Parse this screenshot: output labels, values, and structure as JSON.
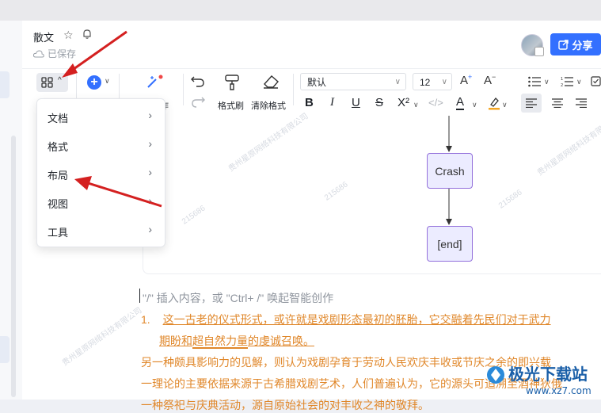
{
  "header": {
    "doc_title": "散文",
    "saved_status": "已保存",
    "share_label": "分享"
  },
  "toolbar": {
    "insert_suffix": "作",
    "format_painter": "格式刷",
    "clear_format": "清除格式",
    "font_family": "默认",
    "font_size": "12",
    "bold": "B",
    "italic": "I",
    "underline": "U",
    "strike": "S",
    "superscript": "X²",
    "text_color": "A"
  },
  "menu": {
    "items": [
      {
        "label": "文档"
      },
      {
        "label": "格式"
      },
      {
        "label": "布局"
      },
      {
        "label": "视图"
      },
      {
        "label": "工具"
      }
    ]
  },
  "diagram": {
    "nodes": [
      {
        "label": "Crash"
      },
      {
        "label": "[end]"
      }
    ]
  },
  "editor": {
    "placeholder": "\"/\" 插入内容，或 \"Ctrl+ /\" 唤起智能创作",
    "list_number": "1.",
    "line1": "这一古老的仪式形式，或许就是戏剧形态最初的胚胎，它交融着先民们对于武力",
    "line2_a": "期盼和",
    "line2_b": "超自然力量",
    "line2_c": "的虔诚召唤。",
    "line3": "另一种颇具影响力的见解，则认为戏剧孕育于劳动人民欢庆丰收或节庆之余的即兴载",
    "line4": "一理论的主要依据来源于古希腊戏剧艺术，人们普遍认为，它的源头可追溯至酒神狄俄",
    "line5": "一种祭祀与庆典活动，源自原始社会的对丰收之神的敬拜。"
  },
  "watermark": {
    "text1": "215686",
    "text2": "贵州星原网络科技有限公司"
  },
  "logo": {
    "text": "极光下载站",
    "url": "www.xz7.com"
  }
}
